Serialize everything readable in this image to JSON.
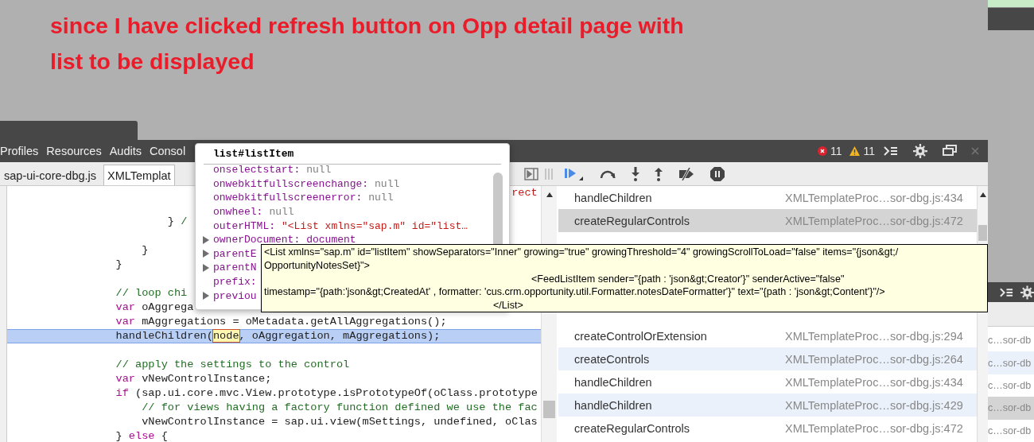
{
  "annotation": [
    "since I have clicked refresh button on Opp detail page with",
    "list to be displayed"
  ],
  "devtools": {
    "menu": [
      {
        "label": "Profiles"
      },
      {
        "label": "Resources"
      },
      {
        "label": "Audits"
      },
      {
        "label": "Consol"
      }
    ],
    "errors": "11",
    "warnings": "11",
    "file_tabs": [
      {
        "label": "sap-ui-core-dbg.js",
        "selected": false
      },
      {
        "label": "XMLTemplat",
        "selected": true
      }
    ],
    "code_lines": [
      {
        "highlighted": false,
        "segments": [
          {
            "kind": "string",
            "text": "                                                                             rect"
          }
        ]
      },
      {
        "highlighted": false
      },
      {
        "highlighted": false,
        "segments": [
          {
            "kind": "plain",
            "text": "                        } "
          },
          {
            "kind": "comment",
            "text": "/"
          }
        ]
      },
      {
        "highlighted": false
      },
      {
        "highlighted": false,
        "segments": [
          {
            "kind": "plain",
            "text": "                    }"
          }
        ]
      },
      {
        "highlighted": false,
        "segments": [
          {
            "kind": "plain",
            "text": "                }"
          }
        ]
      },
      {
        "highlighted": false
      },
      {
        "highlighted": false,
        "segments": [
          {
            "kind": "comment",
            "text": "                // loop chi"
          }
        ]
      },
      {
        "highlighted": false,
        "segments": [
          {
            "kind": "keyword",
            "text": "                var"
          },
          {
            "kind": "plain",
            "text": " oAggrega"
          }
        ]
      },
      {
        "highlighted": false,
        "segments": [
          {
            "kind": "keyword",
            "text": "                var"
          },
          {
            "kind": "plain",
            "text": " mAggregations = oMetadata.getAllAggregations();"
          }
        ]
      },
      {
        "highlighted": true,
        "segments": [
          {
            "kind": "plain",
            "text": "                handleChildren("
          },
          {
            "kind": "match",
            "text": "node"
          },
          {
            "kind": "plain",
            "text": ", oAggregation, mAggregations);"
          }
        ]
      },
      {
        "highlighted": false
      },
      {
        "highlighted": false,
        "segments": [
          {
            "kind": "comment",
            "text": "                // apply the settings to the control"
          }
        ]
      },
      {
        "highlighted": false,
        "segments": [
          {
            "kind": "keyword",
            "text": "                var"
          },
          {
            "kind": "plain",
            "text": " vNewControlInstance;"
          }
        ]
      },
      {
        "highlighted": false,
        "segments": [
          {
            "kind": "keyword",
            "text": "                if"
          },
          {
            "kind": "plain",
            "text": " (sap.ui.core.mvc.View.prototype.isPrototypeOf(oClass.prototype"
          }
        ]
      },
      {
        "highlighted": false,
        "segments": [
          {
            "kind": "comment",
            "text": "                    // for views having a factory function defined we use the fac"
          }
        ]
      },
      {
        "highlighted": false,
        "segments": [
          {
            "kind": "plain",
            "text": "                    vNewControlInstance = sap.ui.view(mSettings, undefined, oClas"
          }
        ]
      },
      {
        "highlighted": false,
        "segments": [
          {
            "kind": "plain",
            "text": "                } "
          },
          {
            "kind": "keyword",
            "text": "else"
          },
          {
            "kind": "plain",
            "text": " {"
          }
        ]
      }
    ],
    "call_stack": {
      "groups": [
        [
          {
            "function": "handleChildren",
            "location": "XMLTemplateProc…sor-dbg.js:434",
            "selected": false
          },
          {
            "function": "createRegularControls",
            "location": "XMLTemplateProc…sor-dbg.js:472",
            "selected": true
          }
        ],
        [
          {
            "function": "createControlOrExtension",
            "location": "XMLTemplateProc…sor-dbg.js:294",
            "selected": false
          },
          {
            "function": "createControls",
            "location": "XMLTemplateProc…sor-dbg.js:264",
            "selected": false
          },
          {
            "function": "handleChildren",
            "location": "XMLTemplateProc…sor-dbg.js:434",
            "selected": false
          },
          {
            "function": "handleChildren",
            "location": "XMLTemplateProc…sor-dbg.js:429",
            "selected": false
          },
          {
            "function": "createRegularControls",
            "location": "XMLTemplateProc…sor-dbg.js:472",
            "selected": false
          }
        ]
      ]
    }
  },
  "popover": {
    "title": "list#listItem",
    "properties": [
      {
        "name": "onselectstart:",
        "value": "null",
        "kind": "null",
        "expandable": false
      },
      {
        "name": "onwebkitfullscreenchange:",
        "value": "null",
        "kind": "null",
        "expandable": false
      },
      {
        "name": "onwebkitfullscreenerror:",
        "value": "null",
        "kind": "null",
        "expandable": false
      },
      {
        "name": "onwheel:",
        "value": "null",
        "kind": "null",
        "expandable": false
      },
      {
        "name": "outerHTML:",
        "value": "\"<List xmlns=\"sap.m\" id=\"list…",
        "kind": "string",
        "expandable": false
      },
      {
        "name": "ownerDocument:",
        "value": "document",
        "kind": "object",
        "expandable": true
      },
      {
        "name": "parentE",
        "expandable": true
      },
      {
        "name": "parentN",
        "expandable": true
      },
      {
        "name": "prefix:",
        "expandable": false
      },
      {
        "name": "previou",
        "expandable": true
      }
    ]
  },
  "tooltip": {
    "lines": [
      {
        "kind": "plain",
        "text": "<List xmlns=\"sap.m\" id=\"listItem\" showSeparators=\"Inner\" growing=\"true\" growingThreshold=\"4\" growingScrollToLoad=\"false\" items=\"{json&gt;/"
      },
      {
        "kind": "plain",
        "text": "OpportunityNotesSet}\">"
      },
      {
        "kind": "child",
        "text": "<FeedListItem sender=\"{path : 'json&gt;Creator'}\" senderActive=\"false\""
      },
      {
        "kind": "plain",
        "text": "timestamp=\"{path:'json&gt;CreatedAt' , formatter: 'cus.crm.opportunity.util.Formatter.notesDateFormatter'}\" text=\"{path : 'json&gt;Content'}\"/>"
      },
      {
        "kind": "close",
        "text": "</List>"
      }
    ]
  },
  "background_window": {
    "rows": [
      {
        "location": "c…sor-db",
        "selected": false
      },
      {
        "location": "c…sor-db",
        "selected": false
      },
      {
        "location": "c…sor-db",
        "selected": false
      },
      {
        "location": "c…sor-db",
        "selected": true
      },
      {
        "location": "c…sor-db",
        "selected": false
      }
    ]
  }
}
